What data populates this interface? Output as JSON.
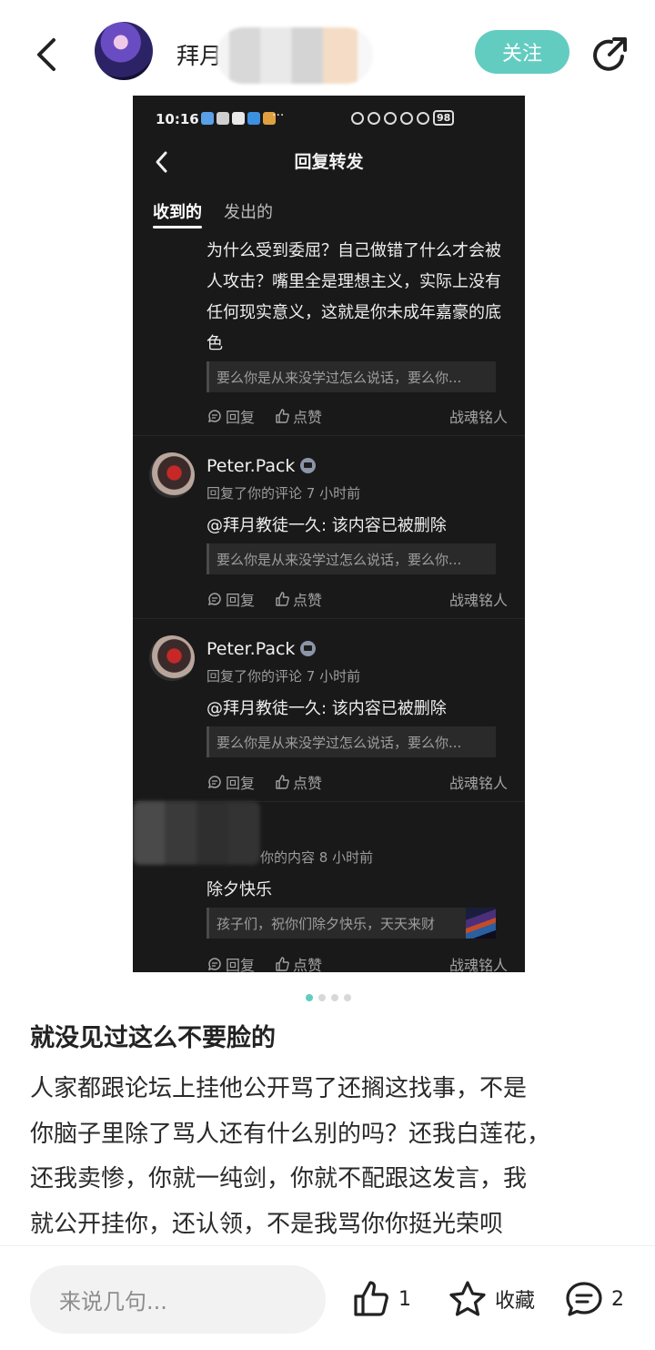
{
  "header": {
    "username": "拜月",
    "follow_label": "关注"
  },
  "screenshot": {
    "status": {
      "time": "10:16",
      "dots": "···",
      "battery": "98"
    },
    "nav_title": "回复转发",
    "tabs": [
      {
        "label": "收到的",
        "active": true
      },
      {
        "label": "发出的",
        "active": false
      }
    ],
    "first_item": {
      "text": "为什么受到委屈？自己做错了什么才会被人攻击？嘴里全是理想主义，实际上没有任何现实意义，这就是你未成年嘉豪的底色",
      "quote": "要么你是从来没学过怎么说话，要么你...",
      "reply_label": "回复",
      "like_label": "点赞",
      "signer": "战魂铭人"
    },
    "items": [
      {
        "name": "Peter.Pack",
        "meta": "回复了你的评论 7 小时前",
        "text": "@拜月教徒一久: 该内容已被删除",
        "quote": "要么你是从来没学过怎么说话，要么你...",
        "reply_label": "回复",
        "like_label": "点赞",
        "signer": "战魂铭人"
      },
      {
        "name": "Peter.Pack",
        "meta": "回复了你的评论 7 小时前",
        "text": "@拜月教徒一久: 该内容已被删除",
        "quote": "要么你是从来没学过怎么说话，要么你...",
        "reply_label": "回复",
        "like_label": "点赞",
        "signer": "战魂铭人"
      }
    ],
    "last_item": {
      "meta": "你的内容 8 小时前",
      "text": "除夕快乐",
      "quote": "孩子们，祝你们除夕快乐，天天来财",
      "reply_label": "回复",
      "like_label": "点赞",
      "signer": "战魂铭人"
    }
  },
  "carousel": {
    "count": 4,
    "active_index": 0
  },
  "post": {
    "title": "就没见过这么不要脸的",
    "lines": [
      "人家都跟论坛上挂他公开骂了还搁这找事，不是",
      "你脑子里除了骂人还有什么别的吗？还我白莲花，",
      "还我卖惨，你就一纯剑，你就不配跟这发言，我",
      "就公开挂你，还认领，不是我骂你你挺光荣呗"
    ]
  },
  "bottom_bar": {
    "comment_placeholder": "来说几句...",
    "like_count": "1",
    "collect_label": "收藏",
    "comment_count": "2"
  },
  "colors": {
    "accent": "#63ccc0",
    "screenshot_bg": "#191919"
  },
  "icons": [
    "back-arrow-icon",
    "share-icon",
    "chevron-left-icon",
    "reply-icon",
    "thumbs-up-icon",
    "star-icon",
    "comment-bubble-icon",
    "verified-badge-icon"
  ]
}
